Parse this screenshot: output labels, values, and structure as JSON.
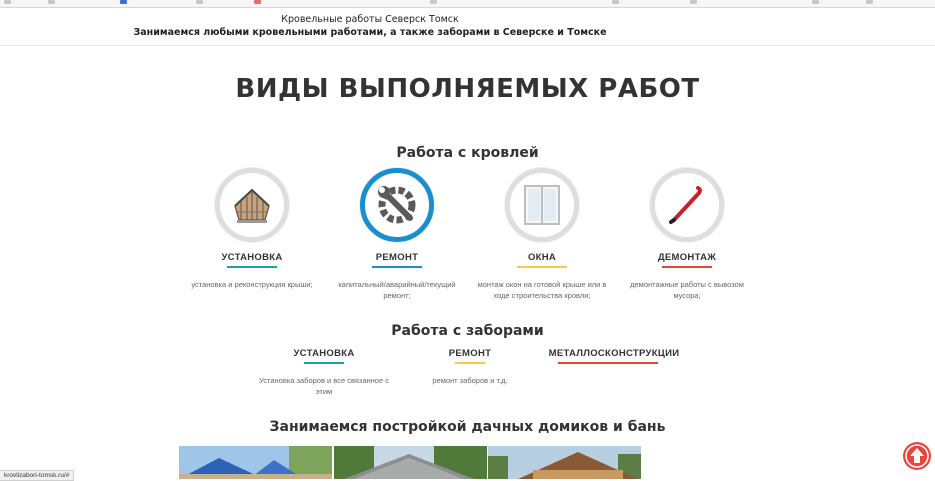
{
  "header": {
    "line1": "Кровельные работы Северск Томск",
    "line2": "Занимаемся любыми кровельными работами, а также заборами в Северске и Томске"
  },
  "main_title": "ВИДЫ ВЫПОЛНЯЕМЫХ РАБОТ",
  "roof_section": {
    "title": "Работа с кровлей",
    "cards": [
      {
        "label": "УСТАНОВКА",
        "desc": "установка и реконструкция крыши;",
        "accent": "#1aa3a3",
        "icon": "house-frame-icon"
      },
      {
        "label": "РЕМОНТ",
        "desc": "капитальный/аварийный/текущий ремонт;",
        "accent": "#1a8fcf",
        "icon": "wrench-gear-icon"
      },
      {
        "label": "ОКНА",
        "desc": "монтаж окон на готовой крыше или в ходе строительства кровли;",
        "accent": "#f2c94c",
        "icon": "window-icon"
      },
      {
        "label": "ДЕМОНТАЖ",
        "desc": "демонтажные работы с вывозом мусора;",
        "accent": "#e8453c",
        "icon": "crowbar-icon"
      }
    ]
  },
  "fence_section": {
    "title": "Работа с заборами",
    "cards": [
      {
        "label": "УСТАНОВКА",
        "desc": "Установка заборов и все связанное с этим",
        "accent": "#1aa3a3"
      },
      {
        "label": "РЕМОНТ",
        "desc": "ремонт заборов и т.д.",
        "accent": "#f2c94c"
      },
      {
        "label": "МЕТАЛЛОСКОНСТРУКЦИИ",
        "desc": "",
        "accent": "#e8453c"
      }
    ]
  },
  "dacha_section": {
    "title": "Занимаемся постройкой дачных домиков и бань"
  },
  "status_url": "krovlizabori-tomsk.ru/#",
  "scroll_top_icon": "arrow-up-icon"
}
